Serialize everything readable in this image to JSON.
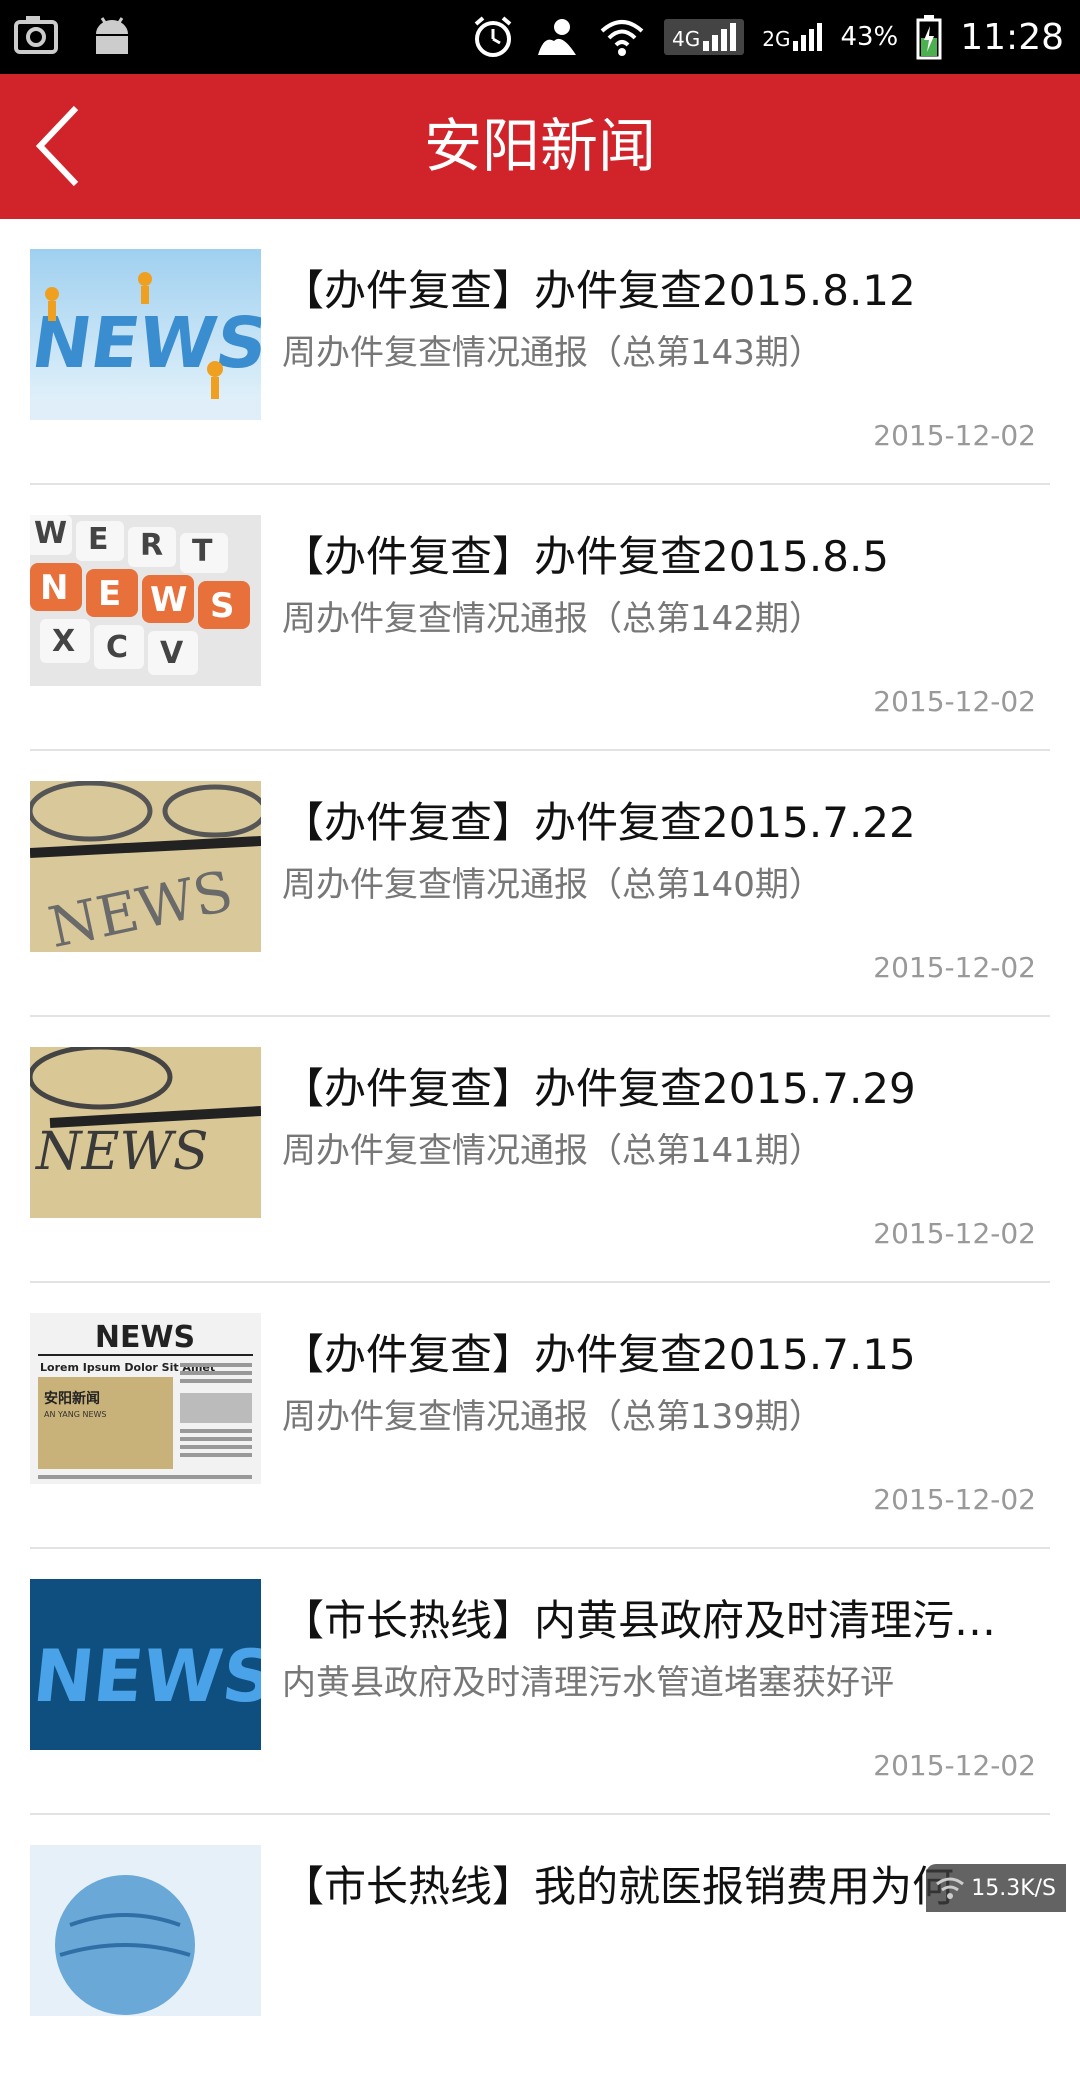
{
  "status_bar": {
    "network_4g": "4G",
    "network_2g": "2G",
    "battery": "43%",
    "time": "11:28",
    "icons": [
      "camera-icon",
      "android-icon",
      "alarm-icon",
      "person-icon",
      "wifi-icon",
      "signal-icon",
      "battery-icon"
    ]
  },
  "header": {
    "title": "安阳新闻",
    "color": "#d1232a"
  },
  "news": [
    {
      "title": "【办件复查】办件复查2015.8.12",
      "subtitle": "周办件复查情况通报（总第143期）",
      "date": "2015-12-02",
      "thumb": "news-3d-letters"
    },
    {
      "title": "【办件复查】办件复查2015.8.5",
      "subtitle": "周办件复查情况通报（总第142期）",
      "date": "2015-12-02",
      "thumb": "news-keyboard"
    },
    {
      "title": "【办件复查】办件复查2015.7.22",
      "subtitle": "周办件复查情况通报（总第140期）",
      "date": "2015-12-02",
      "thumb": "news-glasses-pen"
    },
    {
      "title": "【办件复查】办件复查2015.7.29",
      "subtitle": "周办件复查情况通报（总第141期）",
      "date": "2015-12-02",
      "thumb": "news-glasses-pen"
    },
    {
      "title": "【办件复查】办件复查2015.7.15",
      "subtitle": "周办件复查情况通报（总第139期）",
      "date": "2015-12-02",
      "thumb": "newspaper"
    },
    {
      "title": "【市长热线】内黄县政府及时清理污…",
      "subtitle": "内黄县政府及时清理污水管道堵塞获好评",
      "date": "2015-12-02",
      "thumb": "news-blue-3d"
    },
    {
      "title": "【市长热线】我的就医报销费用为何",
      "subtitle": "",
      "date": "",
      "thumb": "globe"
    }
  ],
  "thumbs_text": {
    "news_word": "NEWS",
    "keyboard_keys": [
      "W",
      "E",
      "R",
      "T",
      "N",
      "E",
      "W",
      "S",
      "X",
      "C",
      "V"
    ],
    "newspaper_headline": "NEWS",
    "newspaper_sub": "Lorem Ipsum Dolor Sit Amet",
    "newspaper_brand": "安阳新闻",
    "newspaper_brand_en": "AN YANG NEWS"
  },
  "speed_indicator": "15.3K/S"
}
